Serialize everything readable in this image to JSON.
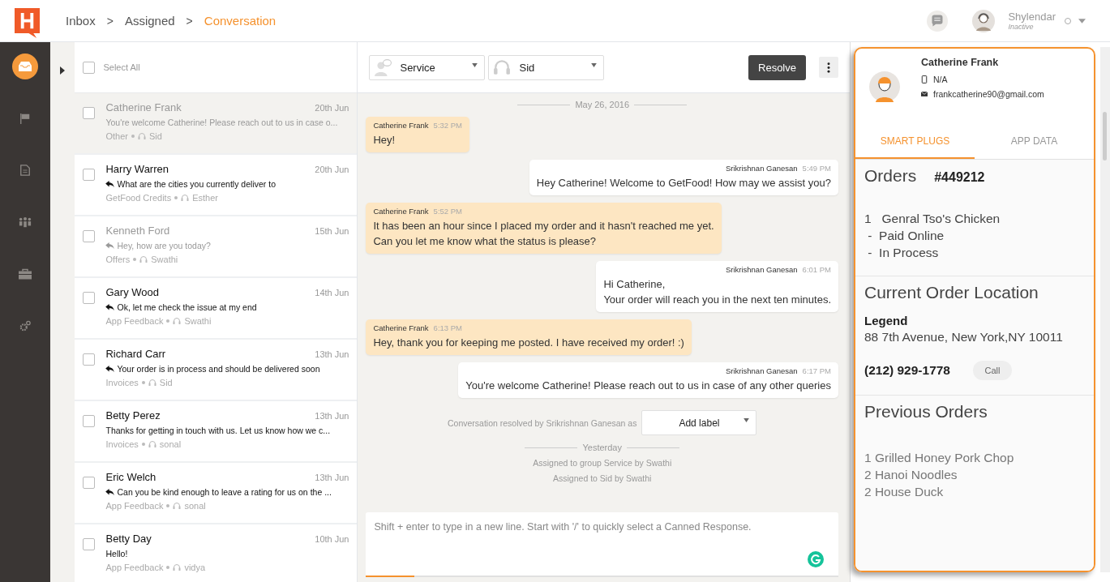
{
  "breadcrumb": [
    {
      "label": "Inbox",
      "selected": false
    },
    {
      "label": "Assigned",
      "selected": false
    },
    {
      "label": "Conversation",
      "selected": true
    }
  ],
  "separator": ">",
  "user": {
    "name": "Shylendar",
    "status": "Inactive"
  },
  "nav_items": [
    {
      "kind": "inbox",
      "selected": true
    },
    {
      "kind": "flag",
      "selected": false
    },
    {
      "kind": "document",
      "selected": false
    },
    {
      "kind": "people",
      "selected": false
    },
    {
      "kind": "briefcase",
      "selected": false
    },
    {
      "kind": "gears",
      "selected": false
    }
  ],
  "select_all": {
    "label": "Select All",
    "checked": false
  },
  "conversations": [
    {
      "name": "Catherine Frank",
      "date": "20th Jun",
      "preview": "You're welcome Catherine! Please reach out to us in case o...",
      "replied": false,
      "read": true,
      "category": "Other",
      "agent": "Sid",
      "selected": true,
      "checked": false
    },
    {
      "name": "Harry Warren",
      "date": "20th Jun",
      "preview": "What are the cities you currently deliver to",
      "replied": true,
      "read": false,
      "category": "GetFood Credits",
      "agent": "Esther",
      "selected": false,
      "checked": false
    },
    {
      "name": "Kenneth Ford",
      "date": "15th Jun",
      "preview": "Hey, how are you today?",
      "replied": true,
      "read": true,
      "category": "Offers",
      "agent": "Swathi",
      "selected": false,
      "checked": false
    },
    {
      "name": "Gary Wood",
      "date": "14th Jun",
      "preview": "Ok, let me check the issue at my end",
      "replied": true,
      "read": false,
      "category": "App Feedback",
      "agent": "Swathi",
      "selected": false,
      "checked": false
    },
    {
      "name": "Richard Carr",
      "date": "13th Jun",
      "preview": "Your order is in process and should be delivered soon",
      "replied": true,
      "read": false,
      "category": "Invoices",
      "agent": "Sid",
      "selected": false,
      "checked": false
    },
    {
      "name": "Betty Perez",
      "date": "13th Jun",
      "preview": "Thanks for getting in touch with us. Let us know how we c...",
      "replied": false,
      "read": false,
      "category": "Invoices",
      "agent": "sonal",
      "selected": false,
      "checked": false
    },
    {
      "name": "Eric Welch",
      "date": "13th Jun",
      "preview": "Can you be kind enough to leave a rating for us on the ...",
      "replied": true,
      "read": false,
      "category": "App Feedback",
      "agent": "sonal",
      "selected": false,
      "checked": false
    },
    {
      "name": "Betty Day",
      "date": "10th Jun",
      "preview": "Hello!",
      "replied": false,
      "read": false,
      "category": "App Feedback",
      "agent": "vidya",
      "selected": false,
      "checked": false
    }
  ],
  "toolbar": {
    "group": "Service",
    "agent": "Sid",
    "resolve": "Resolve"
  },
  "timeline": [
    {
      "kind": "date",
      "text": "May 26, 2016"
    },
    {
      "kind": "customer",
      "sender": "Catherine Frank",
      "time": "5:32 PM",
      "lines": [
        "Hey!"
      ]
    },
    {
      "kind": "agent",
      "sender": "Srikrishnan Ganesan",
      "time": "5:49 PM",
      "lines": [
        "Hey Catherine! Welcome to GetFood! How may we assist you?"
      ]
    },
    {
      "kind": "customer",
      "sender": "Catherine Frank",
      "time": "5:52 PM",
      "lines": [
        "It has been an hour since I placed my order and it hasn't reached me yet.",
        "Can you let me know what the status is please?"
      ]
    },
    {
      "kind": "agent",
      "sender": "Srikrishnan Ganesan",
      "time": "6:01 PM",
      "lines": [
        "Hi Catherine,",
        "Your order will reach you in the next ten minutes."
      ]
    },
    {
      "kind": "customer",
      "sender": "Catherine Frank",
      "time": "6:13 PM",
      "lines": [
        "Hey, thank you for keeping me posted. I have received my order! :)"
      ]
    },
    {
      "kind": "agent",
      "sender": "Srikrishnan Ganesan",
      "time": "6:17 PM",
      "lines": [
        "You're welcome Catherine! Please reach out to us in case of any other queries"
      ]
    },
    {
      "kind": "resolved",
      "text": "Conversation resolved by Srikrishnan Ganesan as",
      "label": "Add label"
    },
    {
      "kind": "date",
      "text": "Yesterday"
    },
    {
      "kind": "event",
      "text": "Assigned to group Service by Swathi"
    },
    {
      "kind": "event",
      "text": "Assigned to Sid by Swathi"
    }
  ],
  "composer": {
    "placeholder": "Shift + enter to type in a new line. Start with '/' to quickly select a Canned Response."
  },
  "contact": {
    "name": "Catherine Frank",
    "phone": "N/A",
    "email": "frankcatherine90@gmail.com"
  },
  "panel_tabs": [
    {
      "label": "SMART PLUGS",
      "selected": true
    },
    {
      "label": "APP DATA",
      "selected": false
    }
  ],
  "orders": {
    "title": "Orders",
    "number": "#449212",
    "lines": [
      "1   Genral Tso's Chicken",
      " -  Paid Online",
      " -  In Process"
    ]
  },
  "location": {
    "title": "Current Order Location",
    "name": "Legend",
    "address": "88 7th Avenue, New York,NY 10011",
    "phone": "(212) 929-1778",
    "call": "Call"
  },
  "previous_orders": {
    "title": "Previous Orders",
    "items": [
      "1 Grilled Honey Pork Chop",
      "2 Hanoi Noodles",
      "2 House Duck"
    ]
  }
}
